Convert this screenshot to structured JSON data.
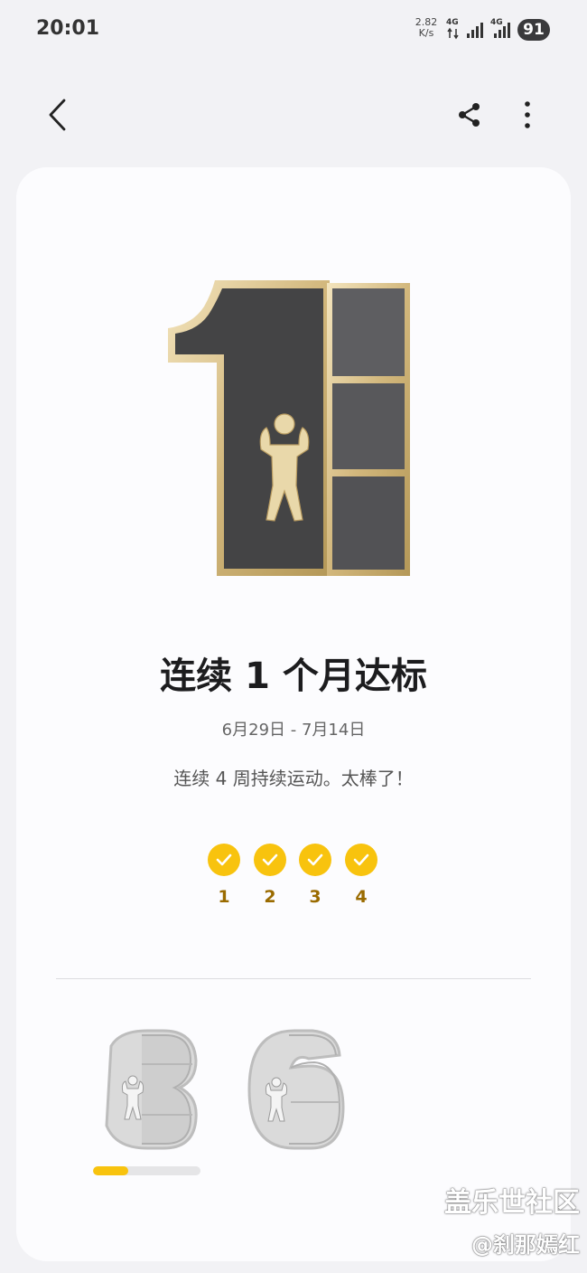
{
  "status_bar": {
    "time": "20:01",
    "net_speed_value": "2.82",
    "net_speed_unit": "K/s",
    "network_1": "4G",
    "network_2": "4G",
    "battery": "91"
  },
  "toolbar": {
    "back_icon": "chevron-left-icon",
    "share_icon": "share-icon",
    "more_icon": "more-vertical-icon"
  },
  "achievement": {
    "badge_icon": "number-1-trophy-badge",
    "title": "连续 1 个月达标",
    "date_range": "6月29日 - 7月14日",
    "description": "连续 4 周持续运动。太棒了！",
    "weeks": [
      {
        "label": "1",
        "done": true
      },
      {
        "label": "2",
        "done": true
      },
      {
        "label": "3",
        "done": true
      },
      {
        "label": "4",
        "done": true
      }
    ],
    "accent_color": "#f8c30e",
    "week_label_color": "#9a6b00"
  },
  "next_badges": [
    {
      "icon": "number-3-badge-locked",
      "progress": 0.33
    },
    {
      "icon": "number-6-badge-locked"
    }
  ],
  "watermark": {
    "line1": "盖乐世社区",
    "line2": "@刹那嫣红"
  }
}
